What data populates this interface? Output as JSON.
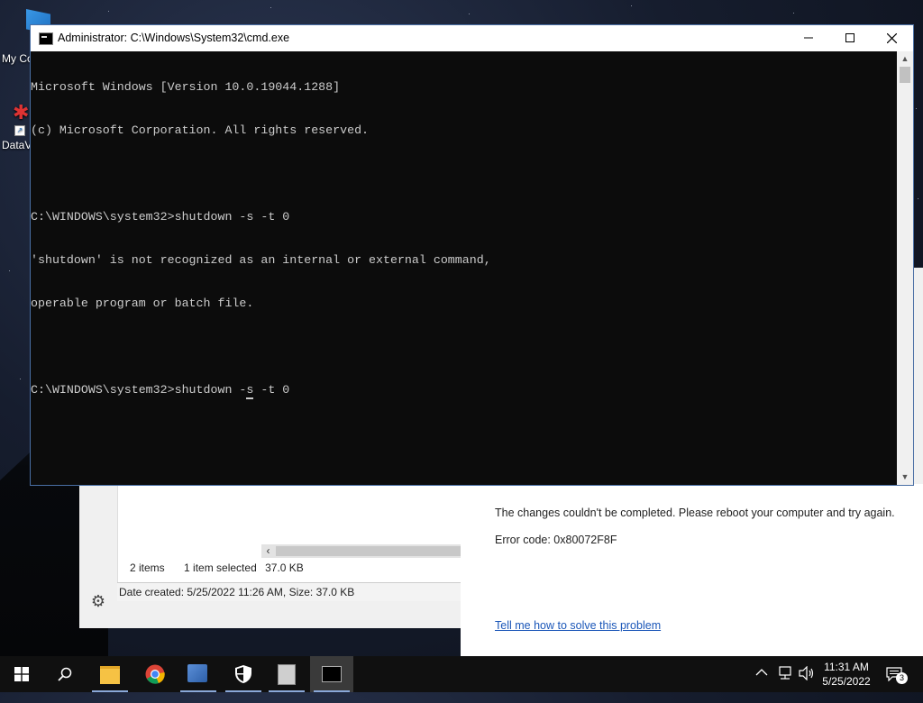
{
  "desktop": {
    "icons": [
      {
        "label": "My Co"
      },
      {
        "label": "DataV"
      }
    ]
  },
  "cmd_window": {
    "title": "Administrator: C:\\Windows\\System32\\cmd.exe",
    "lines": [
      "Microsoft Windows [Version 10.0.19044.1288]",
      "(c) Microsoft Corporation. All rights reserved.",
      "",
      "C:\\WINDOWS\\system32>shutdown -s -t 0",
      "'shutdown' is not recognized as an internal or external command,",
      "operable program or batch file.",
      ""
    ],
    "current_prompt": "C:\\WINDOWS\\system32>shutdown -",
    "cursor_char": "s",
    "current_rest": " -t 0"
  },
  "explorer": {
    "items_count": "2 items",
    "selected": "1 item selected",
    "size": "37.0 KB",
    "details": "Date created: 5/25/2022 11:26 AM, Size: 37.0 KB"
  },
  "error_panel": {
    "message": "The changes couldn't be completed. Please reboot your computer and try again.",
    "error_code": "Error code: 0x80072F8F",
    "help_link": "Tell me how to solve this problem"
  },
  "taskbar": {
    "apps": [
      "start",
      "search",
      "file-explorer",
      "chrome",
      "network-app",
      "security-app",
      "archive-app",
      "cmd"
    ],
    "clock_time": "11:31 AM",
    "clock_date": "5/25/2022",
    "notification_count": "3"
  }
}
